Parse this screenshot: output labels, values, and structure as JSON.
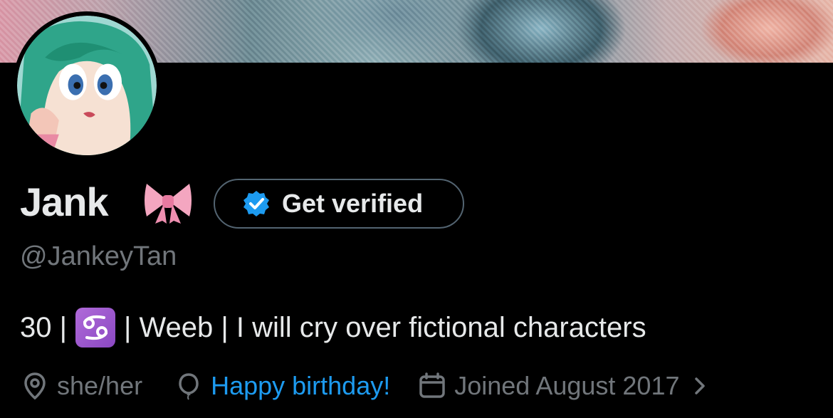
{
  "profile": {
    "display_name": "Jank",
    "name_emoji": "bow-emoji",
    "handle": "@JankeyTan",
    "verify_button_label": "Get verified",
    "bio": {
      "age_prefix": "30 |",
      "zodiac_icon": "cancer-zodiac-icon",
      "text": "| Weeb | I will cry over fictional characters"
    },
    "meta": {
      "pronouns": "she/her",
      "birthday_text": "Happy birthday!",
      "joined": "Joined August 2017"
    }
  },
  "colors": {
    "background": "#000000",
    "primary_text": "#e7e9ea",
    "secondary_text": "#71767b",
    "accent_blue": "#1d9bf0",
    "button_border": "#536471"
  }
}
